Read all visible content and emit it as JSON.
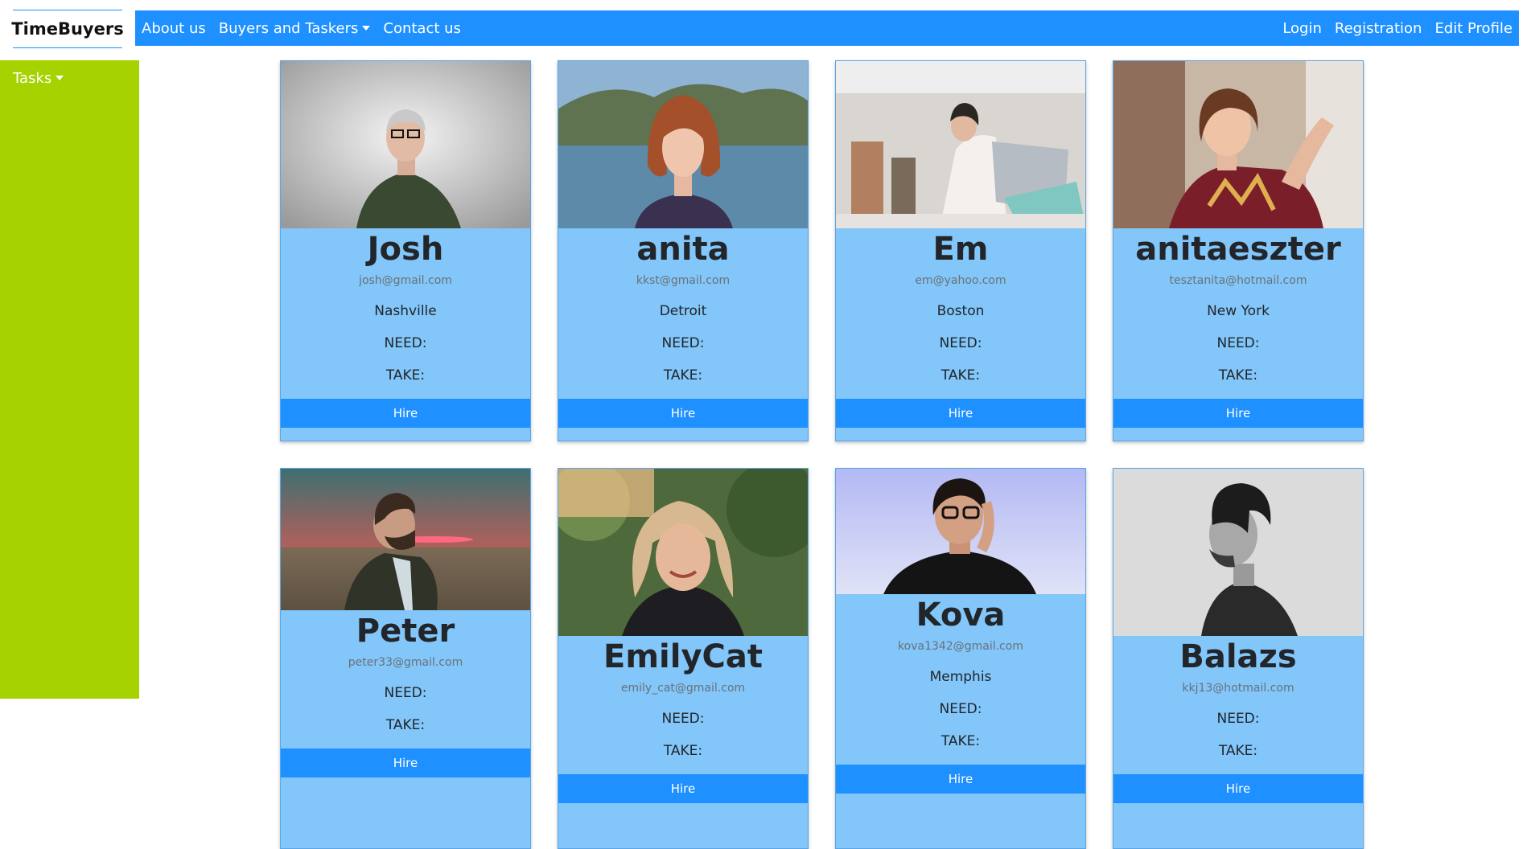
{
  "brand": "TimeBuyers",
  "nav": {
    "left": [
      "About us",
      "Buyers and Taskers",
      "Contact us"
    ],
    "right": [
      "Login",
      "Registration",
      "Edit Profile"
    ]
  },
  "sidebar": {
    "tasks_label": "Tasks"
  },
  "labels": {
    "need": "NEED:",
    "take": "TAKE:",
    "hire": "Hire"
  },
  "cards": [
    {
      "name": "Josh",
      "email": "josh@gmail.com",
      "city": "Nashville",
      "photo": "man-glasses-green-shirt"
    },
    {
      "name": "anita",
      "email": "kkst@gmail.com",
      "city": "Detroit",
      "photo": "redhead-woman-lake"
    },
    {
      "name": "Em",
      "email": "em@yahoo.com",
      "city": "Boston",
      "photo": "woman-laptop-office"
    },
    {
      "name": "anitaeszter",
      "email": "tesztanita@hotmail.com",
      "city": "New York",
      "photo": "woman-smiling-floral-shirt"
    },
    {
      "name": "Peter",
      "email": "peter33@gmail.com",
      "city": "",
      "photo": "bearded-man-sunset-profile"
    },
    {
      "name": "EmilyCat",
      "email": "emily_cat@gmail.com",
      "city": "",
      "photo": "blonde-woman-garden"
    },
    {
      "name": "Kova",
      "email": "kova1342@gmail.com",
      "city": "Memphis",
      "photo": "woman-adjusting-glasses"
    },
    {
      "name": "Balazs",
      "email": "kkj13@hotmail.com",
      "city": "",
      "photo": "man-profile-black-white"
    }
  ]
}
